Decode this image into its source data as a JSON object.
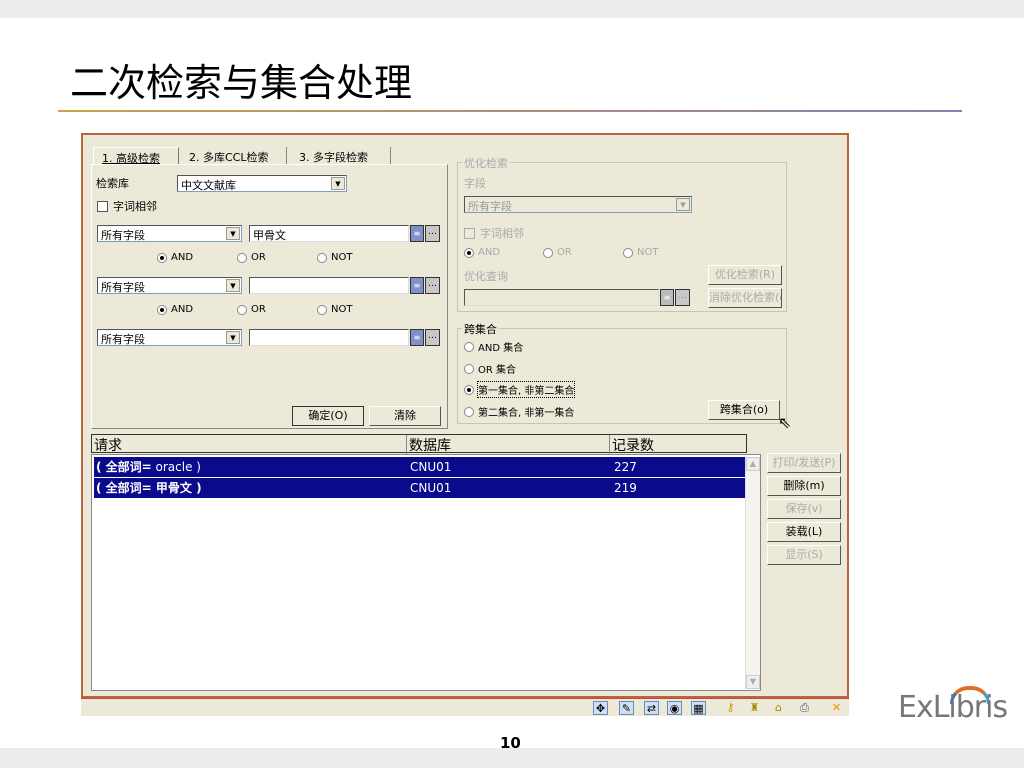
{
  "slide": {
    "title": "二次检索与集合处理",
    "page_number": "10",
    "logo": "ExLibris"
  },
  "tabs": [
    "1. 高级检索",
    "2. 多库CCL检索",
    "3. 多字段检索"
  ],
  "advanced": {
    "db_label": "检索库",
    "db_value": "中文文献库",
    "adjacent_label": "字词相邻",
    "rows": [
      {
        "field": "所有字段",
        "term": "甲骨文"
      },
      {
        "field": "所有字段",
        "term": ""
      },
      {
        "field": "所有字段",
        "term": ""
      }
    ],
    "ops": [
      "AND",
      "OR",
      "NOT"
    ],
    "ok": "确定(O)",
    "clear": "清除"
  },
  "refine": {
    "group_title": "优化检索",
    "field_label": "字段",
    "field_value": "所有字段",
    "adjacent_label": "字词相邻",
    "ops": [
      "AND",
      "OR",
      "NOT"
    ],
    "query_label": "优化查询",
    "refine_button": "优化检索(R)",
    "remove_button": "消除优化检索(e)"
  },
  "cross": {
    "group_title": "跨集合",
    "options": [
      "AND 集合",
      "OR 集合",
      "第一集合, 非第二集合",
      "第二集合, 非第一集合"
    ],
    "selected": 2,
    "button": "跨集合(o)"
  },
  "results": {
    "headers": [
      "请求",
      "数据库",
      "记录数"
    ],
    "rows": [
      {
        "request_prefix": "( 全部词=",
        "request_term": " oracle )",
        "db": "CNU01",
        "count": "227"
      },
      {
        "request_prefix": "( 全部词=",
        "request_term": " 甲骨文 )",
        "db": "CNU01",
        "count": "219"
      }
    ]
  },
  "side_buttons": [
    {
      "label": "打印/发送(P)",
      "enabled": false
    },
    {
      "label": "删除(m)",
      "enabled": true
    },
    {
      "label": "保存(v)",
      "enabled": false
    },
    {
      "label": "装载(L)",
      "enabled": true
    },
    {
      "label": "显示(S)",
      "enabled": false
    }
  ]
}
